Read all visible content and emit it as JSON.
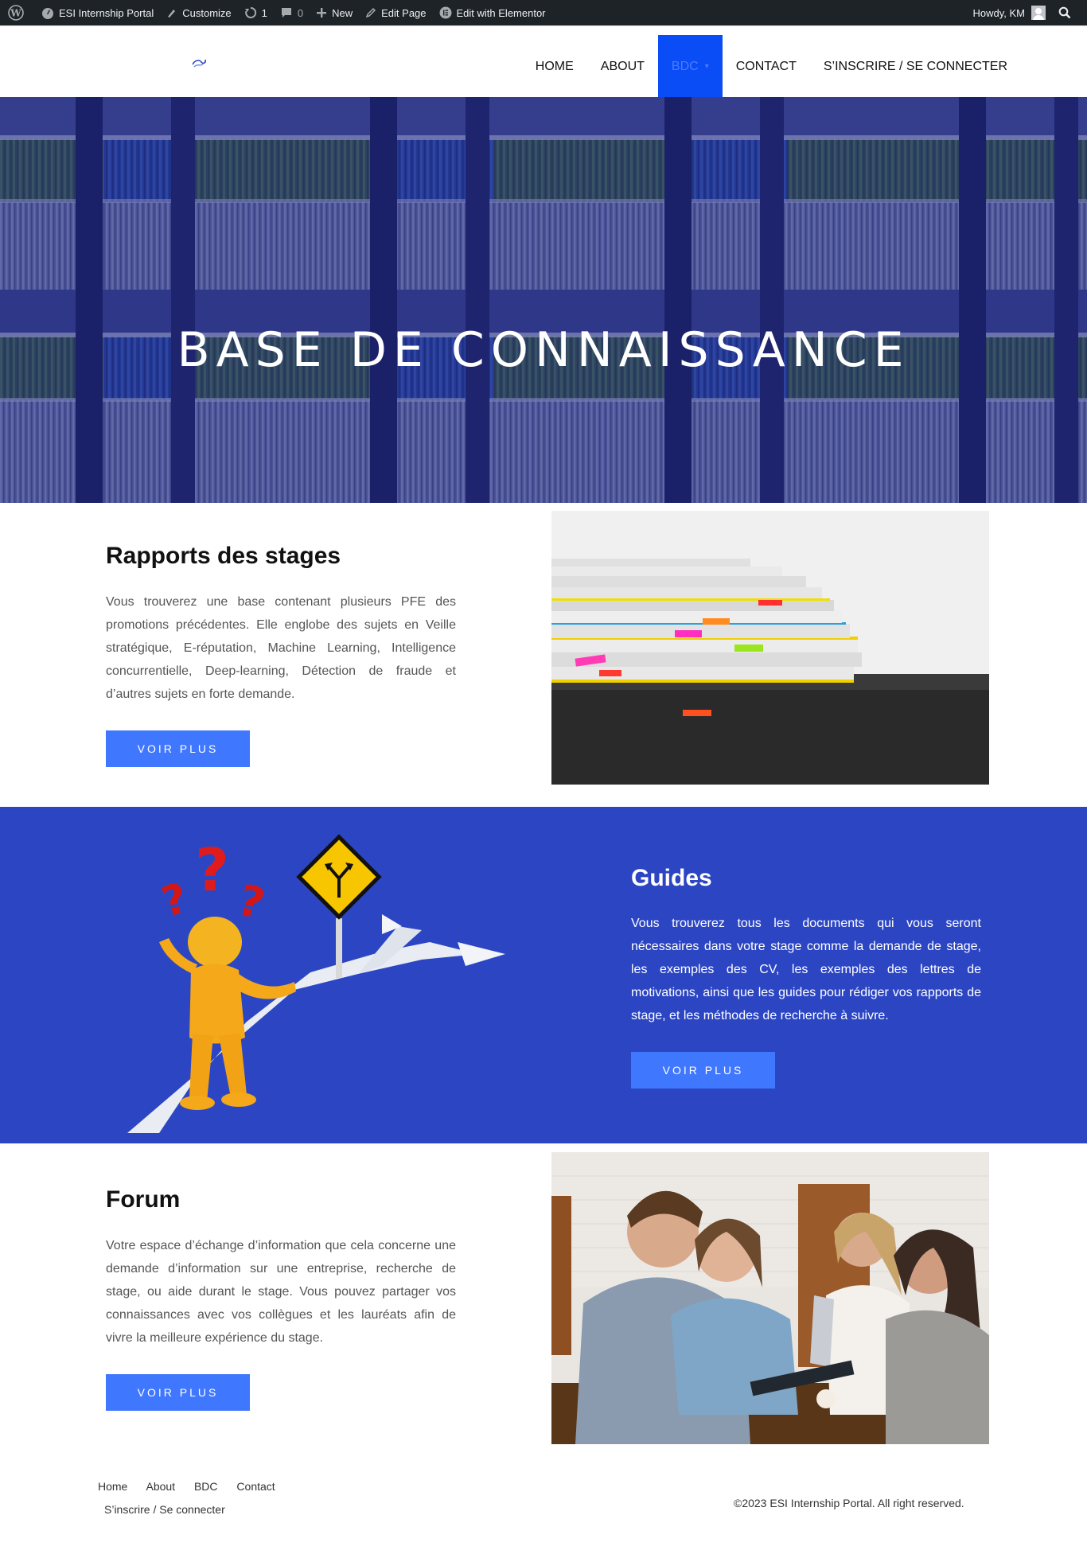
{
  "adminbar": {
    "site_name": "ESI Internship Portal",
    "customize": "Customize",
    "updates_count": "1",
    "comments_count": "0",
    "new": "New",
    "edit_page": "Edit Page",
    "edit_elementor": "Edit with Elementor",
    "howdy": "Howdy, KM"
  },
  "nav": {
    "items": [
      {
        "label": "HOME"
      },
      {
        "label": "ABOUT"
      },
      {
        "label": "BDC"
      },
      {
        "label": "CONTACT"
      },
      {
        "label": "S’INSCRIRE / SE CONNECTER"
      }
    ],
    "active_color": "#0a4cf5"
  },
  "hero": {
    "title": "BASE DE CONNAISSANCE"
  },
  "rapports": {
    "title": "Rapports des stages",
    "text": "Vous trouverez une base contenant plusieurs PFE des promotions précédentes. Elle englobe des sujets en Veille stratégique, E-réputation, Machine Learning, Intelligence concurrentielle, Deep-learning, Détection de fraude et d’autres sujets en forte demande.",
    "button": "VOIR PLUS"
  },
  "guides": {
    "title": "Guides",
    "text": "Vous trouverez tous les documents qui vous seront nécessaires dans votre stage comme la demande de stage, les exemples des CV, les exemples des lettres de motivations, ainsi que les guides pour rédiger vos rapports de stage, et les méthodes de recherche à suivre.",
    "button": "VOIR PLUS",
    "band_color": "#2c46c3"
  },
  "forum": {
    "title": "Forum",
    "text": "Votre espace d’échange d’information que cela concerne une demande d’information sur une entreprise, recherche de stage, ou aide durant le stage. Vous pouvez partager vos connaissances avec vos collègues et les lauréats afin de vivre la meilleure expérience du stage.",
    "button": "VOIR PLUS"
  },
  "footer": {
    "links": [
      "Home",
      "About",
      "BDC",
      "Contact"
    ],
    "link_signin": "S’inscrire / Se connecter",
    "copyright": "©2023 ESI Internship Portal. All right reserved."
  },
  "colors": {
    "button": "#4077ff",
    "admin_bar": "#1d2327"
  }
}
